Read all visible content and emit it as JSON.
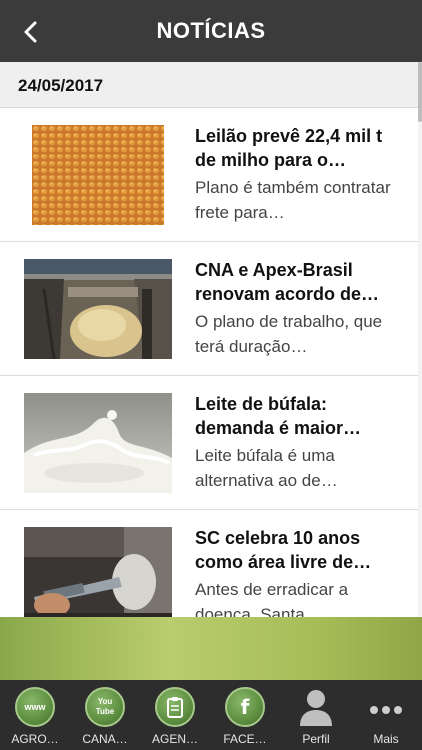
{
  "header": {
    "title": "NOTÍCIAS"
  },
  "list": {
    "date": "24/05/2017",
    "items": [
      {
        "title": "Leilão prevê 22,4 mil t de milho para o…",
        "description": "Plano é também contratar frete para…",
        "image": "corn-grain-photo"
      },
      {
        "title": "CNA e Apex-Brasil renovam acordo de…",
        "description": "O plano de trabalho, que terá duração…",
        "image": "grain-truck-photo"
      },
      {
        "title": "Leite de búfala: demanda é maior…",
        "description": "Leite búfala é uma alternativa ao de…",
        "image": "milk-splash-photo"
      },
      {
        "title": "SC celebra 10 anos como área livre de…",
        "description": "Antes de erradicar a doença, Santa…",
        "image": "vaccine-syringe-photo"
      }
    ]
  },
  "tabs": [
    {
      "label": "AGRO…",
      "icon": "www-globe-icon",
      "icon_text": "www"
    },
    {
      "label": "CANA…",
      "icon": "youtube-icon",
      "icon_text": "You\nTube"
    },
    {
      "label": "AGEN…",
      "icon": "clipboard-icon",
      "icon_text": ""
    },
    {
      "label": "FACE…",
      "icon": "facebook-icon",
      "icon_text": "f"
    },
    {
      "label": "Perfil",
      "icon": "person-icon",
      "icon_text": ""
    },
    {
      "label": "Mais",
      "icon": "more-dots-icon",
      "icon_text": ""
    }
  ],
  "colors": {
    "topbar": "#3b3b3b",
    "tabbar": "#2d2d2d",
    "banner": "#a6bd57",
    "tab_icon_green": "#5e8f40"
  }
}
